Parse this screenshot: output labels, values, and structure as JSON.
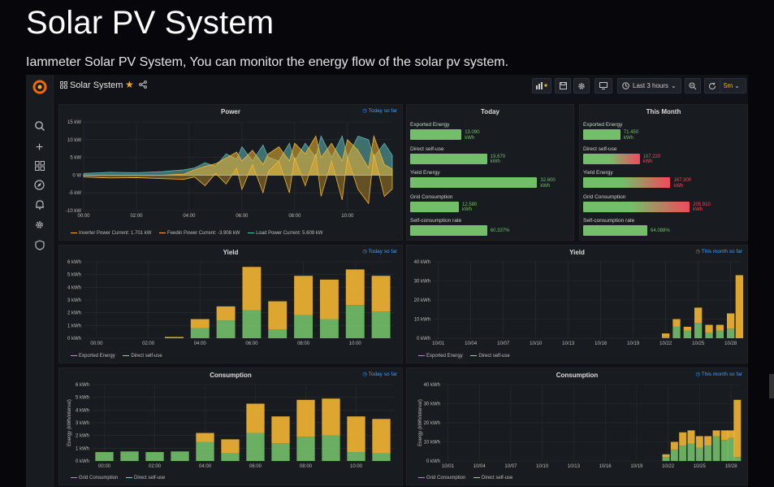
{
  "page": {
    "title": "Solar PV System",
    "subtitle": "Iammeter Solar PV System, You can monitor the energy flow of the solar pv system."
  },
  "colors": {
    "green": "#73bf69",
    "yellow": "#f2b632",
    "teal": "#5fb7b3",
    "red": "#f2495c",
    "link": "#3ea0ff",
    "panel": "#181b1f"
  },
  "topbar": {
    "dashboard_name": "Solar System",
    "time_range": "Last 3 hours",
    "refresh": "5m"
  },
  "sidebar": {
    "icons": [
      "search-icon",
      "plus-icon",
      "dashboards-icon",
      "explore-icon",
      "alert-bell-icon",
      "settings-gear-icon",
      "shield-icon"
    ]
  },
  "panels": {
    "power": {
      "title": "Power",
      "link": "Today so far",
      "legend": [
        "Inverter Power  Current: 1.701 kW",
        "Feedin Power  Current: -3.908 kW",
        "Load Power  Current: 5.609 kW"
      ]
    },
    "today": {
      "title": "Today",
      "rows": [
        {
          "label": "Exported Energy",
          "value": "13.090",
          "unit": "kWh",
          "fill": 0.4
        },
        {
          "label": "Direct self-use",
          "value": "19.670",
          "unit": "kWh",
          "fill": 0.6
        },
        {
          "label": "Yield Energy",
          "value": "32.600",
          "unit": "kWh",
          "fill": 0.99
        },
        {
          "label": "Grid Consumption",
          "value": "12.580",
          "unit": "kWh",
          "fill": 0.38
        },
        {
          "label": "Self-consumption rate",
          "value": "60.337%",
          "unit": "",
          "fill": 0.6
        }
      ]
    },
    "month": {
      "title": "This Month",
      "rows": [
        {
          "label": "Exported Energy",
          "value": "71.450",
          "unit": "kWh",
          "fill": 0.29
        },
        {
          "label": "Direct self-use",
          "value": "187.220",
          "unit": "kWh",
          "fill": 0.44
        },
        {
          "label": "Yield Energy",
          "value": "167.300",
          "unit": "kWh",
          "fill": 0.68
        },
        {
          "label": "Grid Consumption",
          "value": "205.910",
          "unit": "kWh",
          "fill": 0.83
        },
        {
          "label": "Self-consumption rate",
          "value": "64.088%",
          "unit": "",
          "fill": 0.5
        }
      ]
    },
    "yield_today": {
      "title": "Yield",
      "link": "Today so far",
      "legend": [
        "Exported Energy",
        "Direct self-use"
      ]
    },
    "yield_month": {
      "title": "Yield",
      "link": "This month so far",
      "legend": [
        "Exported Energy",
        "Direct self-use"
      ]
    },
    "cons_today": {
      "title": "Consumption",
      "link": "Today so far",
      "ylabel": "Energy (kWh/interval)",
      "legend": [
        "Grid Consumption",
        "Direct self-use"
      ]
    },
    "cons_month": {
      "title": "Consumption",
      "link": "This month so far",
      "ylabel": "Energy (kWh/interval)",
      "legend": [
        "Grid Consumption",
        "Direct self-use"
      ]
    }
  },
  "chart_data": [
    {
      "id": "power",
      "type": "area",
      "title": "Power",
      "ylim": [
        -10,
        15
      ],
      "yticks": [
        "15 kW",
        "10 kW",
        "5 kW",
        "0 W",
        "-5 kW",
        "-10 kW"
      ],
      "ytick_values": [
        15,
        10,
        5,
        0,
        -5,
        -10
      ],
      "xticks": [
        "00:00",
        "02:00",
        "04:00",
        "06:00",
        "08:00",
        "10:00"
      ],
      "x_hours": [
        0,
        2,
        4,
        6,
        8,
        10
      ],
      "xlim": [
        0,
        11.7
      ],
      "series": [
        {
          "name": "Inverter Power",
          "color": "#f2b632",
          "x": [
            0,
            1,
            2,
            3,
            3.8,
            4.2,
            4.6,
            5,
            5.4,
            5.8,
            6,
            6.4,
            6.8,
            7,
            7.4,
            7.8,
            8,
            8.4,
            8.8,
            9,
            9.4,
            9.8,
            10,
            10.4,
            10.8,
            11,
            11.4,
            11.7
          ],
          "values": [
            0,
            0,
            0,
            0,
            0.3,
            1.5,
            2.5,
            3.2,
            4.8,
            6.5,
            4,
            7,
            3,
            6,
            8,
            4,
            9,
            6,
            11,
            5,
            9,
            4,
            10,
            7,
            2,
            11,
            3,
            1.7
          ]
        },
        {
          "name": "Feedin Power",
          "color": "#f2b632",
          "x": [
            0,
            1,
            2,
            3,
            3.8,
            4.2,
            4.6,
            5,
            5.4,
            5.8,
            6,
            6.4,
            6.8,
            7,
            7.4,
            7.8,
            8,
            8.4,
            8.8,
            9,
            9.4,
            9.8,
            10,
            10.4,
            10.8,
            11,
            11.4,
            11.7
          ],
          "values": [
            -0.5,
            -0.8,
            -0.7,
            -1,
            -1.2,
            -0.5,
            -3,
            0.5,
            -2.5,
            2,
            -4,
            3,
            -5,
            1,
            4,
            -5,
            5,
            -3,
            6,
            -6,
            4,
            -7,
            5,
            -4,
            -8,
            6,
            -6,
            -3.9
          ]
        },
        {
          "name": "Load Power",
          "color": "#5fb7b3",
          "x": [
            0,
            1,
            2,
            3,
            3.8,
            4.2,
            4.6,
            5,
            5.4,
            5.8,
            6,
            6.4,
            6.8,
            7,
            7.4,
            7.8,
            8,
            8.4,
            8.8,
            9,
            9.4,
            9.8,
            10,
            10.4,
            10.8,
            11,
            11.4,
            11.7
          ],
          "values": [
            0.5,
            0.8,
            0.7,
            1,
            1.5,
            2,
            3.5,
            2.5,
            6,
            4.5,
            8,
            4,
            8.5,
            5,
            4,
            9,
            4,
            9,
            5,
            11,
            5,
            11,
            5,
            11,
            10,
            5,
            9,
            5.6
          ]
        }
      ]
    },
    {
      "id": "yield_today",
      "type": "bar",
      "ylim": [
        0,
        6
      ],
      "yticks": [
        "6 kWh",
        "5 kWh",
        "4 kWh",
        "3 kWh",
        "2 kWh",
        "1 kWh",
        "0 kWh"
      ],
      "ytick_values": [
        6,
        5,
        4,
        3,
        2,
        1,
        0
      ],
      "xticks": [
        "00:00",
        "02:00",
        "04:00",
        "06:00",
        "08:00",
        "10:00"
      ],
      "xlim": [
        0,
        12
      ],
      "x": [
        0.5,
        1.5,
        2.5,
        3.5,
        4.5,
        5.5,
        6.5,
        7.5,
        8.5,
        9.5,
        10.5,
        11.5
      ],
      "series": [
        {
          "name": "Exported Energy",
          "color": "#73bf69",
          "values": [
            0,
            0,
            0,
            0,
            0.8,
            1.4,
            2.2,
            0.7,
            1.8,
            1.5,
            2.6,
            2.1
          ]
        },
        {
          "name": "Direct self-use",
          "color": "#f2b632",
          "values": [
            0,
            0,
            0,
            0.1,
            0.7,
            1.1,
            3.4,
            2.2,
            3.1,
            3.1,
            2.8,
            2.8
          ]
        }
      ]
    },
    {
      "id": "yield_month",
      "type": "bar",
      "ylim": [
        0,
        40
      ],
      "yticks": [
        "40 kWh",
        "30 kWh",
        "20 kWh",
        "10 kWh",
        "0 kWh"
      ],
      "ytick_values": [
        40,
        30,
        20,
        10,
        0
      ],
      "xticks": [
        "10/01",
        "10/04",
        "10/07",
        "10/10",
        "10/13",
        "10/16",
        "10/19",
        "10/22",
        "10/25",
        "10/28"
      ],
      "xtick_days": [
        1,
        4,
        7,
        10,
        13,
        16,
        19,
        22,
        25,
        28
      ],
      "xlim": [
        0.5,
        29
      ],
      "x": [
        22,
        23,
        24,
        25,
        26,
        27,
        28,
        28.8
      ],
      "series": [
        {
          "name": "Exported Energy",
          "color": "#73bf69",
          "values": [
            0.5,
            6,
            4,
            8,
            3,
            4,
            5,
            0
          ]
        },
        {
          "name": "Direct self-use",
          "color": "#f2b632",
          "values": [
            2,
            4,
            2,
            8,
            4,
            3,
            8,
            33
          ]
        }
      ]
    },
    {
      "id": "cons_today",
      "type": "bar",
      "ylim": [
        0,
        6
      ],
      "yticks": [
        "6 kWh",
        "5 kWh",
        "4 kWh",
        "3 kWh",
        "2 kWh",
        "1 kWh",
        "0 kWh"
      ],
      "ytick_values": [
        6,
        5,
        4,
        3,
        2,
        1,
        0
      ],
      "xticks": [
        "00:00",
        "02:00",
        "04:00",
        "06:00",
        "08:00",
        "10:00"
      ],
      "xlim": [
        0,
        12
      ],
      "x": [
        0.5,
        1.5,
        2.5,
        3.5,
        4.5,
        5.5,
        6.5,
        7.5,
        8.5,
        9.5,
        10.5,
        11.5
      ],
      "series": [
        {
          "name": "Grid Consumption",
          "color": "#73bf69",
          "values": [
            0.7,
            0.75,
            0.7,
            0.75,
            1.5,
            0.6,
            2.2,
            1.4,
            1.9,
            2.0,
            0.7,
            0.6
          ]
        },
        {
          "name": "Direct self-use",
          "color": "#f2b632",
          "values": [
            0,
            0,
            0,
            0,
            0.7,
            1.1,
            2.3,
            2.1,
            2.9,
            2.9,
            2.8,
            2.7
          ]
        }
      ]
    },
    {
      "id": "cons_month",
      "type": "bar",
      "ylim": [
        0,
        40
      ],
      "yticks": [
        "40 kWh",
        "30 kWh",
        "20 kWh",
        "10 kWh",
        "0 kWh"
      ],
      "ytick_values": [
        40,
        30,
        20,
        10,
        0
      ],
      "xticks": [
        "10/01",
        "10/04",
        "10/07",
        "10/10",
        "10/13",
        "10/16",
        "10/19",
        "10/22",
        "10/25",
        "10/28"
      ],
      "xtick_days": [
        1,
        4,
        7,
        10,
        13,
        16,
        19,
        22,
        25,
        28
      ],
      "xlim": [
        0.5,
        29
      ],
      "x": [
        21.8,
        22.6,
        23.4,
        24.2,
        25,
        25.8,
        26.6,
        27.4,
        28,
        28.6
      ],
      "series": [
        {
          "name": "Grid Consumption",
          "color": "#73bf69",
          "values": [
            2,
            6,
            8,
            9,
            7,
            8,
            13,
            11,
            12,
            2
          ]
        },
        {
          "name": "Direct self-use",
          "color": "#f2b632",
          "values": [
            1.5,
            4,
            7,
            7,
            6,
            5,
            3,
            5,
            4,
            30
          ]
        }
      ]
    }
  ]
}
